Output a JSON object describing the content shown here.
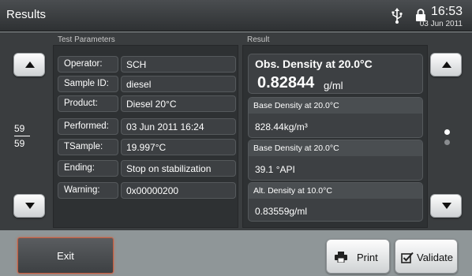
{
  "header": {
    "title": "Results",
    "time": "16:53",
    "date": "03 Jun 2011",
    "icons": [
      "usb-icon",
      "lock-icon"
    ]
  },
  "pager": {
    "current": "59",
    "total": "59"
  },
  "test_parameters": {
    "label": "Test Parameters",
    "rows": [
      {
        "label": "Operator:",
        "value": "SCH"
      },
      {
        "label": "Sample ID:",
        "value": "diesel"
      },
      {
        "label": "Product:",
        "value": "Diesel 20°C"
      },
      {
        "label": "Performed:",
        "value": "03 Jun 2011 16:24"
      },
      {
        "label": "TSample:",
        "value": " 19.997°C"
      },
      {
        "label": "Ending:",
        "value": "Stop on stabilization"
      },
      {
        "label": "Warning:",
        "value": "0x00000200"
      }
    ]
  },
  "result": {
    "label": "Result",
    "main": {
      "title": "Obs. Density at  20.0°C",
      "value": "0.82844",
      "unit": "g/ml"
    },
    "items": [
      {
        "title": "Base Density at  20.0°C",
        "value": "828.44kg/m³"
      },
      {
        "title": "Base Density at  20.0°C",
        "value": " 39.1 °API"
      },
      {
        "title": "Alt. Density at  10.0°C",
        "value": "0.83559g/ml"
      }
    ]
  },
  "footer": {
    "exit_label": "Exit",
    "print_label": "Print",
    "validate_label": "Validate"
  },
  "colors": {
    "header_bg": "#3a3d40",
    "panel_bg": "#2e3133",
    "exit_border": "#c85b3d",
    "background": "#8f9698"
  }
}
